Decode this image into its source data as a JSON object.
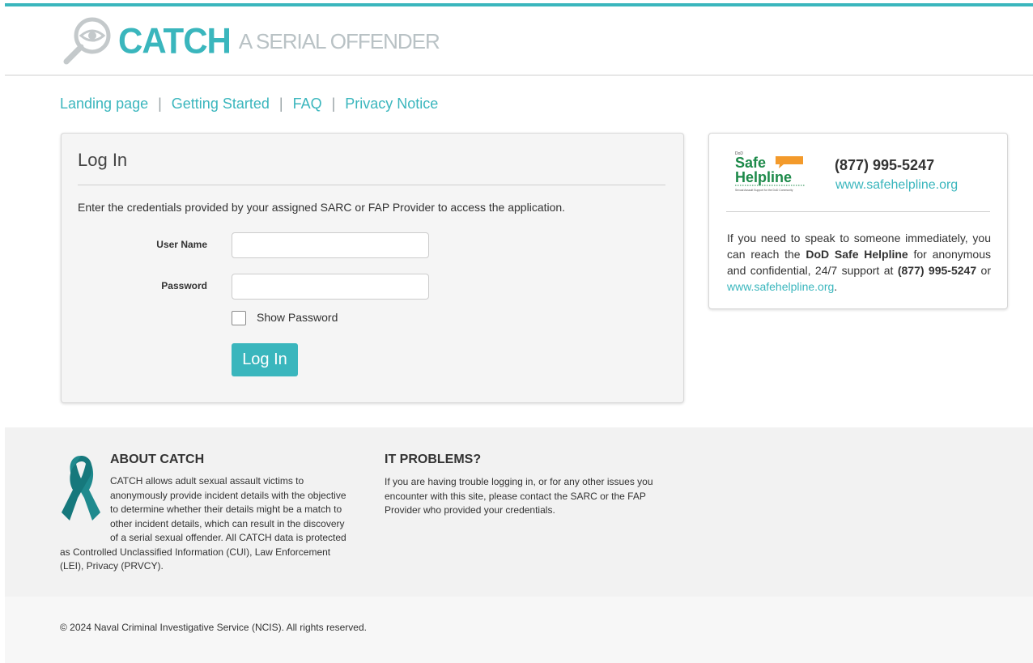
{
  "header": {
    "logo_word": "CATCH",
    "logo_tagline": "A SERIAL OFFENDER"
  },
  "nav": {
    "items": [
      {
        "label": "Landing page"
      },
      {
        "label": "Getting Started"
      },
      {
        "label": "FAQ"
      },
      {
        "label": "Privacy Notice"
      }
    ],
    "separator": "|"
  },
  "login": {
    "title": "Log In",
    "intro": "Enter the credentials provided by your assigned SARC or FAP Provider to access the application.",
    "username_label": "User Name",
    "username_value": "",
    "password_label": "Password",
    "password_value": "",
    "show_password_label": "Show Password",
    "show_password_checked": false,
    "submit_label": "Log In"
  },
  "helpline": {
    "logo_word1": "Safe",
    "logo_word2": "Helpline",
    "logo_small_top": "DoD",
    "logo_subtitle": "Sexual Assault Support for the DoD Community",
    "phone": "(877) 995-5247",
    "url": "www.safehelpline.org",
    "text_part1": "If you need to speak to someone immediately, you can reach the ",
    "text_bold1": "DoD Safe Helpline",
    "text_part2": " for anonymous and confidential, 24/7 support at ",
    "text_bold2": "(877) 995-5247",
    "text_part3": " or ",
    "text_link": "www.safehelpline.org",
    "text_end": "."
  },
  "footer": {
    "about_heading": "ABOUT CATCH",
    "about_text": "CATCH allows adult sexual assault victims to anonymously provide incident details with the objective to determine whether their details might be a match to other incident details, which can result in the discovery of a serial sexual offender. All CATCH data is protected as Controlled Unclassified Information (CUI), Law Enforcement (LEI), Privacy (PRVCY).",
    "it_heading": "IT PROBLEMS?",
    "it_text": "If you are having trouble logging in, or for any other issues you encounter with this site, please contact the SARC or the FAP Provider who provided your credentials.",
    "copyright": "© 2024 Naval Criminal Investigative Service (NCIS). All rights reserved."
  },
  "colors": {
    "accent": "#3ab6bd",
    "ribbon": "#1f8a8e",
    "helpline_green": "#1d8a4a",
    "helpline_orange": "#f39a2b"
  }
}
